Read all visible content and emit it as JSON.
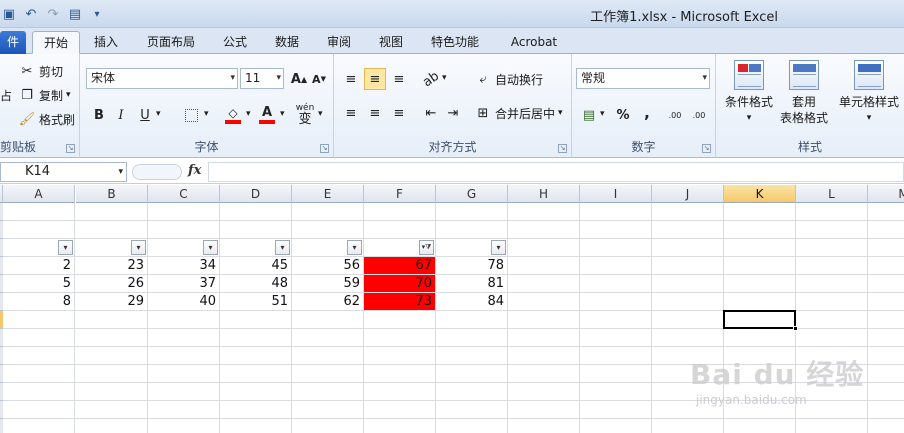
{
  "window": {
    "title": "工作簿1.xlsx  -  Microsoft Excel"
  },
  "quick_access": [
    "save-icon",
    "undo-icon",
    "redo-icon",
    "form-icon",
    "customize-icon"
  ],
  "tabs": [
    {
      "label": "件",
      "name": "file"
    },
    {
      "label": "开始",
      "name": "home",
      "active": true
    },
    {
      "label": "插入",
      "name": "insert"
    },
    {
      "label": "页面布局",
      "name": "page-layout"
    },
    {
      "label": "公式",
      "name": "formulas"
    },
    {
      "label": "数据",
      "name": "data"
    },
    {
      "label": "审阅",
      "name": "review"
    },
    {
      "label": "视图",
      "name": "view"
    },
    {
      "label": "特色功能",
      "name": "features"
    },
    {
      "label": "Acrobat",
      "name": "acrobat"
    }
  ],
  "ribbon": {
    "clipboard": {
      "label": "剪贴板",
      "paste": "占",
      "cut": "剪切",
      "copy": "复制",
      "format_painter": "格式刷"
    },
    "font": {
      "label": "字体",
      "font_name": "宋体",
      "font_size": "11",
      "grow": "A",
      "shrink": "A",
      "bold": "B",
      "italic": "I",
      "underline": "U",
      "phonetic": "wén"
    },
    "alignment": {
      "label": "对齐方式",
      "wrap_text": "自动换行",
      "merge_center": "合并后居中"
    },
    "number": {
      "label": "数字",
      "format": "常规",
      "percent": "%",
      "comma": ",",
      "inc_decimal": ".00",
      "dec_decimal": ".00"
    },
    "styles": {
      "label": "样式",
      "conditional": "条件格式",
      "table_format_1": "套用",
      "table_format_2": "表格格式",
      "cell_styles": "单元格样式"
    }
  },
  "formula_bar": {
    "name_box": "K14",
    "fx": "fx",
    "formula": ""
  },
  "sheet": {
    "columns": [
      "A",
      "B",
      "C",
      "D",
      "E",
      "F",
      "G",
      "H",
      "I",
      "J",
      "K",
      "L",
      "M"
    ],
    "selected_column": "K",
    "filter_row": [
      "",
      "",
      "",
      "",
      "",
      "filtered",
      ""
    ],
    "data_rows": [
      [
        2,
        23,
        34,
        45,
        56,
        67,
        78
      ],
      [
        5,
        26,
        37,
        48,
        59,
        70,
        81
      ],
      [
        8,
        29,
        40,
        51,
        62,
        73,
        84
      ]
    ],
    "highlight_color": "#ff0000",
    "active_cell": "K14"
  },
  "watermark": {
    "text": "Bai du 经验",
    "sub": "jingyan.baidu.com"
  }
}
